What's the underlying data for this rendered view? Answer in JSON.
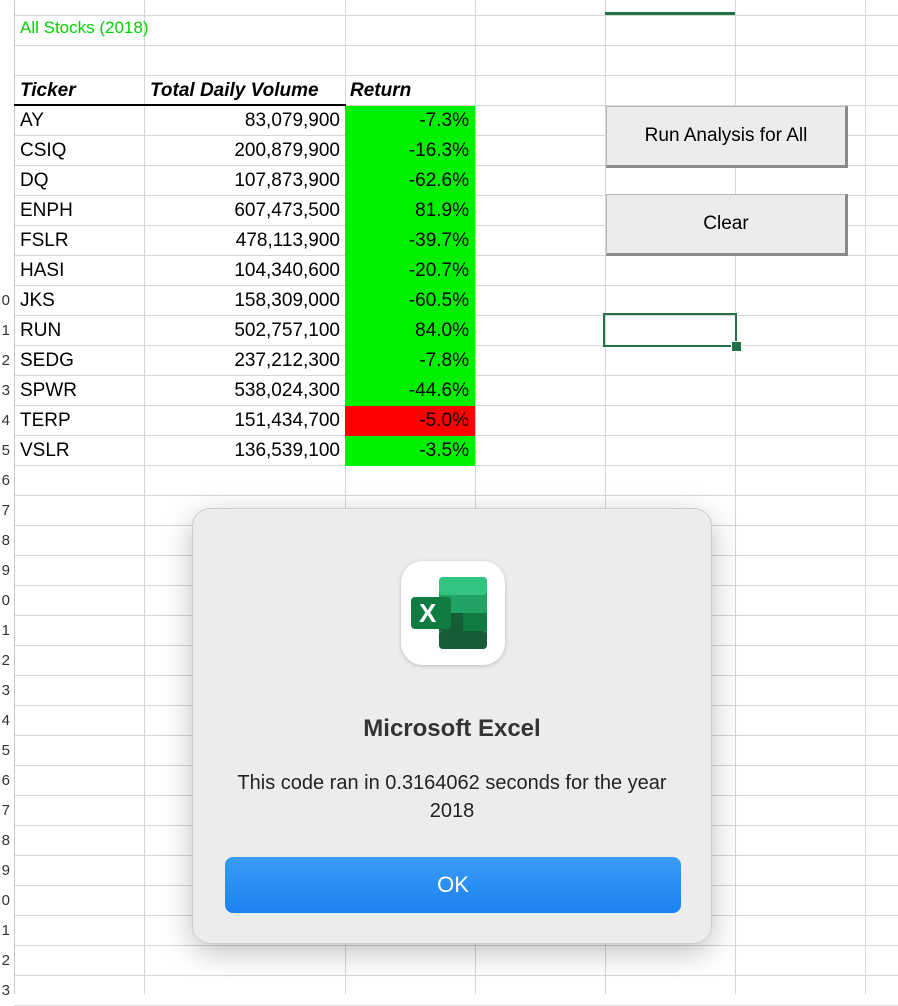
{
  "sheet": {
    "title": "All Stocks (2018)",
    "headers": {
      "ticker": "Ticker",
      "volume": "Total Daily Volume",
      "return": "Return"
    },
    "rows": [
      {
        "ticker": "AY",
        "volume": "83,079,900",
        "return": "-7.3%",
        "status": "green"
      },
      {
        "ticker": "CSIQ",
        "volume": "200,879,900",
        "return": "-16.3%",
        "status": "green"
      },
      {
        "ticker": "DQ",
        "volume": "107,873,900",
        "return": "-62.6%",
        "status": "green"
      },
      {
        "ticker": "ENPH",
        "volume": "607,473,500",
        "return": "81.9%",
        "status": "green"
      },
      {
        "ticker": "FSLR",
        "volume": "478,113,900",
        "return": "-39.7%",
        "status": "green"
      },
      {
        "ticker": "HASI",
        "volume": "104,340,600",
        "return": "-20.7%",
        "status": "green"
      },
      {
        "ticker": "JKS",
        "volume": "158,309,000",
        "return": "-60.5%",
        "status": "green"
      },
      {
        "ticker": "RUN",
        "volume": "502,757,100",
        "return": "84.0%",
        "status": "green"
      },
      {
        "ticker": "SEDG",
        "volume": "237,212,300",
        "return": "-7.8%",
        "status": "green"
      },
      {
        "ticker": "SPWR",
        "volume": "538,024,300",
        "return": "-44.6%",
        "status": "green"
      },
      {
        "ticker": "TERP",
        "volume": "151,434,700",
        "return": "-5.0%",
        "status": "red"
      },
      {
        "ticker": "VSLR",
        "volume": "136,539,100",
        "return": "-3.5%",
        "status": "green"
      }
    ],
    "row_numbers": [
      "0",
      "1",
      "2",
      "3",
      "4",
      "5",
      "6",
      "7",
      "8",
      "9",
      "0",
      "1",
      "2",
      "3",
      "4",
      "5",
      "6",
      "7",
      "8",
      "9",
      "0",
      "1",
      "2",
      "3"
    ]
  },
  "buttons": {
    "run_all": "Run Analysis for All",
    "clear": "Clear"
  },
  "dialog": {
    "app_name": "Microsoft Excel",
    "message": "This code ran in 0.3164062 seconds for the year 2018",
    "ok": "OK",
    "icon_letter": "X"
  },
  "colors": {
    "positive_fill": "#00f000",
    "negative_fill": "#ff0000",
    "title_color": "#00d400",
    "excel_green": "#217346",
    "ok_blue": "#1a82f0"
  }
}
